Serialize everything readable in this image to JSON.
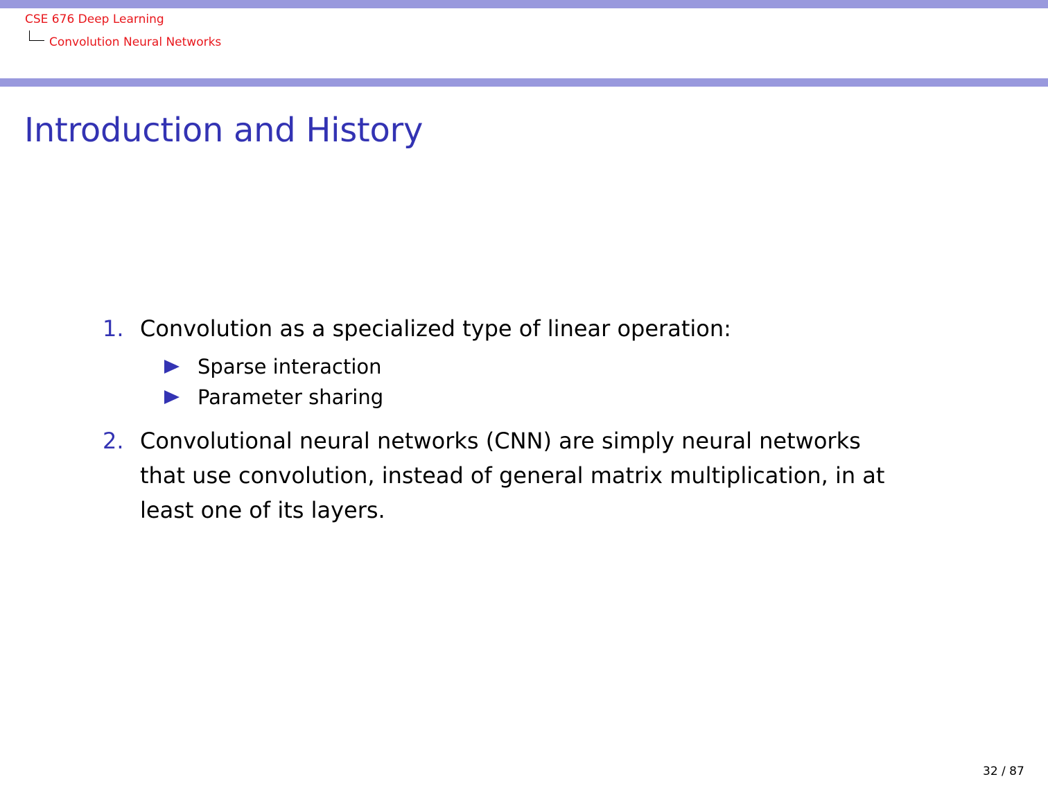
{
  "header": {
    "course_title": "CSE 676 Deep Learning",
    "section_title": "Convolution Neural Networks",
    "bar_color": "#9999dd",
    "breadcrumb_color": "#e8161b"
  },
  "slide": {
    "title": "Introduction and History",
    "title_color": "#3333b3",
    "items": [
      {
        "number": "1.",
        "lines": [
          "Convolution as a specialized type of linear operation:"
        ],
        "subitems": [
          "Sparse interaction",
          "Parameter sharing"
        ]
      },
      {
        "number": "2.",
        "lines": [
          "Convolutional neural networks (CNN) are simply neural networks",
          "that use convolution, instead of general matrix multiplication, in at",
          "least one of its layers."
        ],
        "subitems": []
      }
    ],
    "bullet_icon": "triangle-right-icon"
  },
  "footer": {
    "page": "32 / 87"
  }
}
